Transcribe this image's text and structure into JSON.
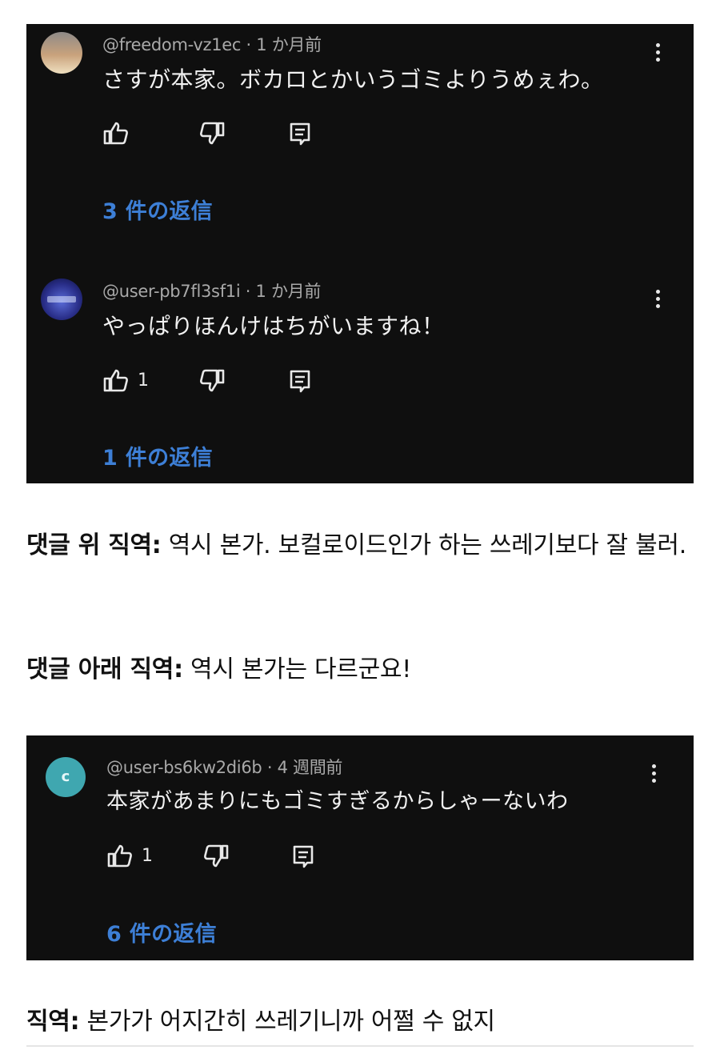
{
  "screenshot1": {
    "comment": {
      "handle": "@freedom-vz1ec",
      "time": "1 か月前",
      "text": "さすが本家。ボカロとかいうゴミよりうめぇわ。",
      "like_count": "",
      "replies": "3 件の返信"
    },
    "reply": {
      "handle": "@user-pb7fl3sf1i",
      "time": "1 か月前",
      "text": "やっぱりほんけはちがいますね！",
      "like_count": "1",
      "replies": "1 件の返信"
    }
  },
  "translation1": {
    "label": "댓글 위 직역:",
    "text": " 역시 본가. 보컬로이드인가 하는 쓰레기보다 잘 불러."
  },
  "translation2": {
    "label": "댓글 아래 직역:",
    "text": " 역시 본가는 다르군요!"
  },
  "screenshot2": {
    "comment": {
      "avatar_letter": "c",
      "handle": "@user-bs6kw2di6b",
      "time": "4 週間前",
      "text": "本家があまりにもゴミすぎるからしゃーないわ",
      "like_count": "1",
      "replies": "6 件の返信"
    }
  },
  "translation3": {
    "label": "직역:",
    "text": " 본가가 어지간히 쓰레기니까 어쩔 수 없지"
  },
  "icons": {
    "like": "thumbs-up-icon",
    "dislike": "thumbs-down-icon",
    "reply": "reply-comment-icon",
    "more": "more-vert-icon"
  },
  "colors": {
    "screenshot_bg": "#0f0f0f",
    "reply_link": "#3d7fd6",
    "meta": "#a9a9a9"
  }
}
